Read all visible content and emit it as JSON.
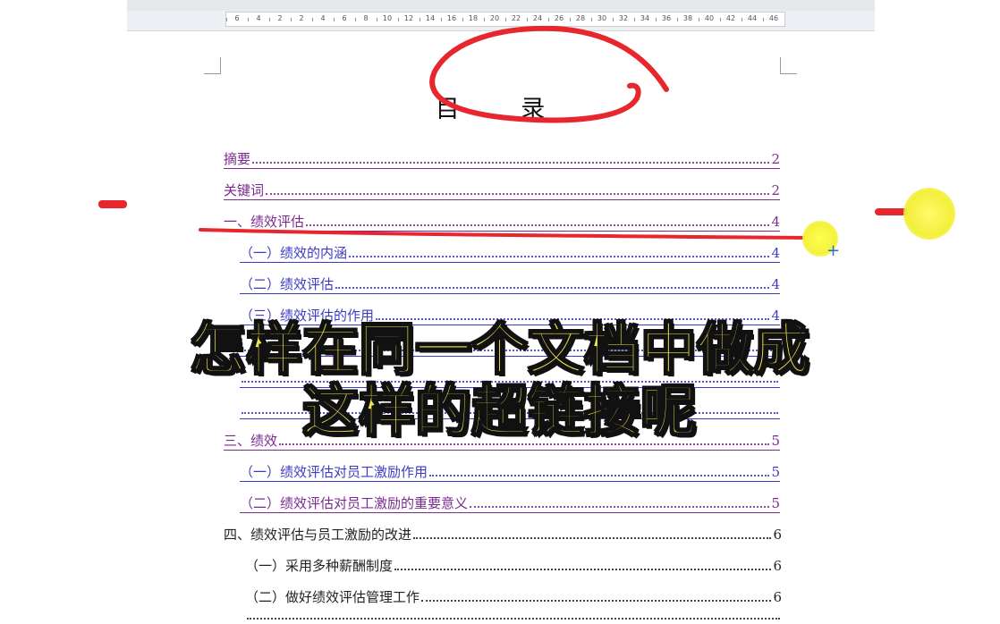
{
  "ruler": {
    "labels": [
      "6",
      "4",
      "2",
      "2",
      "4",
      "6",
      "8",
      "10",
      "12",
      "14",
      "16",
      "18",
      "20",
      "22",
      "24",
      "26",
      "28",
      "30",
      "32",
      "34",
      "36",
      "38",
      "40",
      "42",
      "44",
      "46"
    ]
  },
  "toc": {
    "title": "目 录",
    "entries": [
      {
        "text": "摘要",
        "page": "2",
        "style": "link"
      },
      {
        "text": "关键词",
        "page": "2",
        "style": "link"
      },
      {
        "text": "一、绩效评估",
        "page": "4",
        "style": "link"
      },
      {
        "text": "（一）绩效的内涵",
        "page": "4",
        "style": "link-blue"
      },
      {
        "text": "（二）绩效评估",
        "page": "4",
        "style": "link-blue"
      },
      {
        "text": "（三）绩效评估的作用",
        "page": "4",
        "style": "link-blue"
      },
      {
        "text": "三、绩效",
        "page": "5",
        "style": "link"
      },
      {
        "text": "（一）绩效评估对员工激励作用",
        "page": "5",
        "style": "link-blue"
      },
      {
        "text": "（二）绩效评估对员工激励的重要意义",
        "page": "5",
        "style": "link"
      },
      {
        "text": "四、绩效评估与员工激励的改进",
        "page": "6",
        "style": "plain"
      },
      {
        "text": "（一）采用多种薪酬制度",
        "page": "6",
        "style": "plain"
      },
      {
        "text": "（二）做好绩效评估管理工作",
        "page": "6",
        "style": "plain"
      }
    ]
  },
  "overlay": {
    "line1": "怎样在同一个文档中做成",
    "line2": "这样的超链接呢"
  },
  "colors": {
    "link_purple": "#7a2a8f",
    "link_blue": "#3d3bc4",
    "annotation_red": "#e8262d",
    "caption_yellow": "#f2e64e",
    "cursor_highlight": "#f4f23a"
  }
}
